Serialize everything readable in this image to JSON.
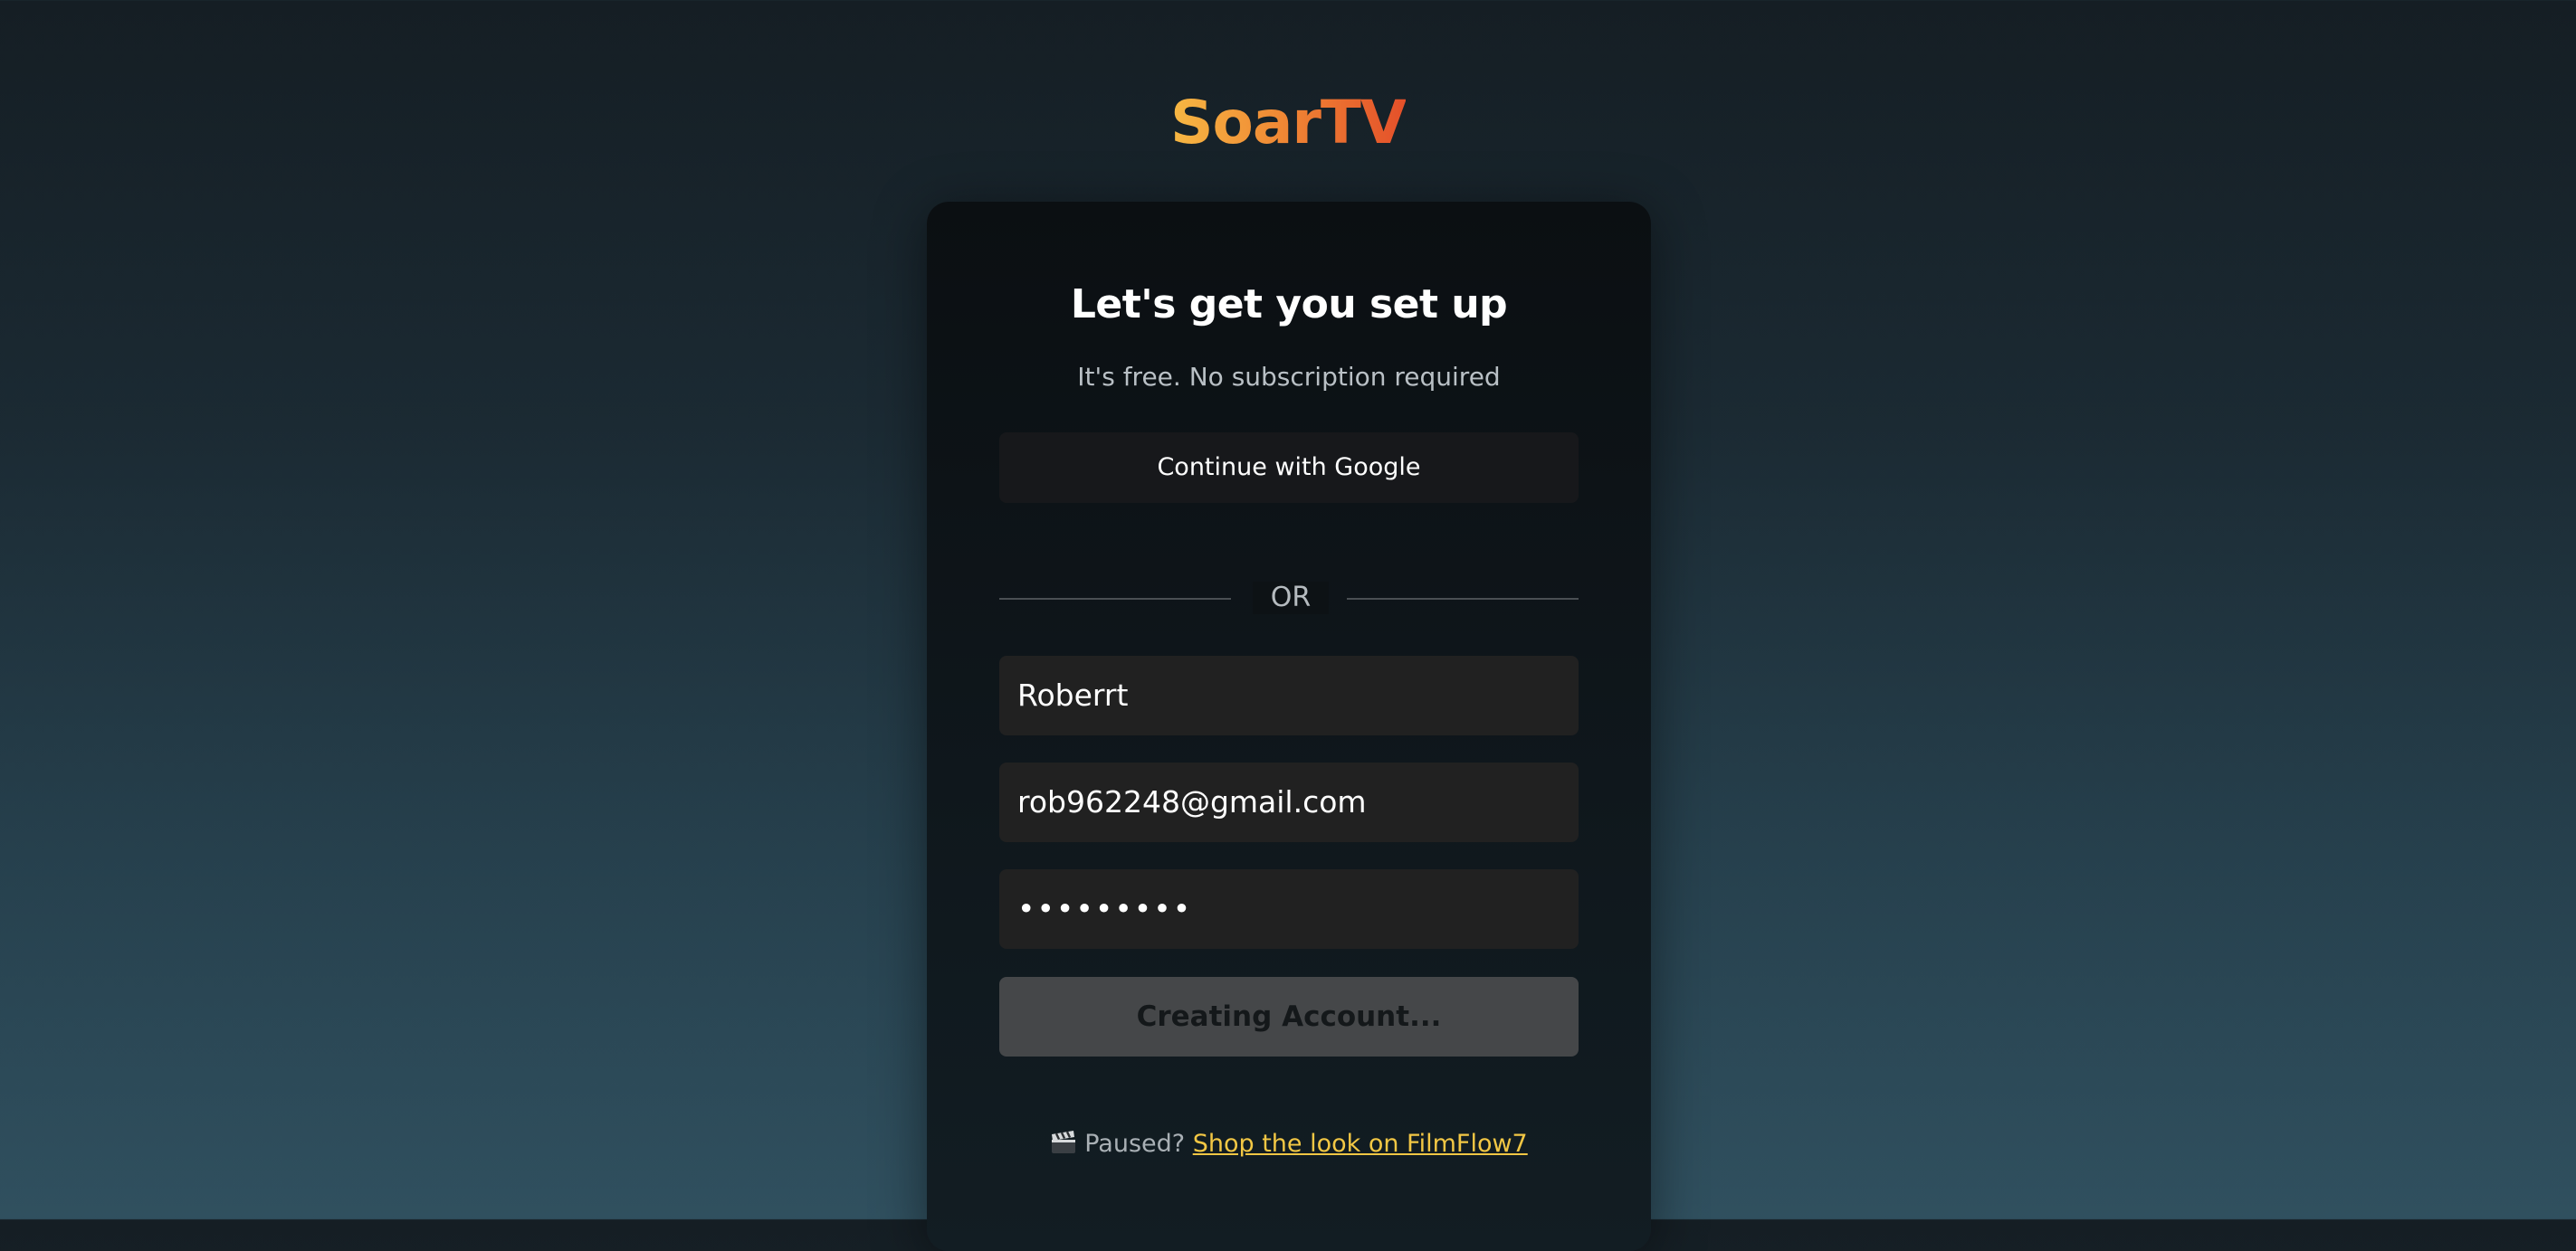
{
  "brand": {
    "name": "SoarTV",
    "gradient_start": "#f7b843",
    "gradient_end": "#e4502a"
  },
  "signup": {
    "title": "Let's get you set up",
    "subtitle": "It's free. No subscription required",
    "google_button_label": "Continue with Google",
    "divider_label": "OR",
    "name_value": "Roberrt",
    "email_value": "rob962248@gmail.com",
    "password_value": "•••••••••",
    "submit_label": "Creating Account...",
    "submit_state": "disabled"
  },
  "promo": {
    "icon": "clapperboard-icon",
    "prefix": "Paused?",
    "link_text": "Shop the look on FilmFlow7",
    "link_color": "#f2c744"
  }
}
